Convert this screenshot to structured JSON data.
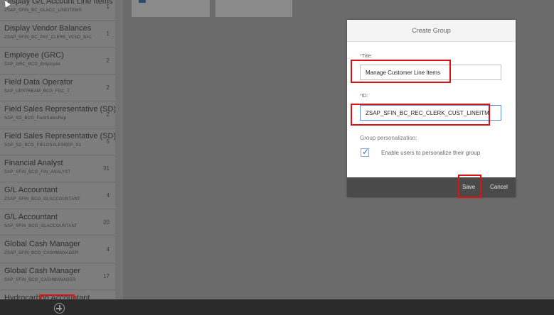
{
  "sidebar": {
    "items": [
      {
        "title": "Display G/L Account Line Items",
        "subtitle": "ZSAP_SFIN_BC_GLACC_LINEITEMS",
        "count": "1"
      },
      {
        "title": "Display Vendor Balances",
        "subtitle": "ZSAP_SFIN_BC_PAY_CLERK_VEND_BAL",
        "count": "1"
      },
      {
        "title": "Employee (GRC)",
        "subtitle": "SAP_GRC_BCG_Employee",
        "count": "2"
      },
      {
        "title": "Field Data Operator",
        "subtitle": "SAP_UPSTREAM_BCG_FDC_T",
        "count": "2"
      },
      {
        "title": "Field Sales Representative (SD)",
        "subtitle": "SAP_SD_BCG_FieldSalesRep",
        "count": "2"
      },
      {
        "title": "Field Sales Representative (SD)",
        "subtitle": "SAP_SD_BCG_FIELDSALESREP_X1",
        "count": "5"
      },
      {
        "title": "Financial Analyst",
        "subtitle": "SAP_SFIN_BCG_FIN_ANALYST",
        "count": "31"
      },
      {
        "title": "G/L Accountant",
        "subtitle": "ZSAP_SFIN_BCG_GLACCOUNTANT",
        "count": "4"
      },
      {
        "title": "G/L Accountant",
        "subtitle": "SAP_SFIN_BCG_GLACCOUNTANT",
        "count": "20"
      },
      {
        "title": "Global Cash Manager",
        "subtitle": "ZSAP_SFIN_BCG_CASHMANAGER",
        "count": "4"
      },
      {
        "title": "Global Cash Manager",
        "subtitle": "SAP_SFIN_BCG_CASHMANAGER",
        "count": "17"
      },
      {
        "title": "Hydrocarbon Accountant",
        "subtitle": "",
        "count": ""
      }
    ]
  },
  "dialog": {
    "title": "Create Group",
    "title_label": "Title:",
    "title_value": "Manage Customer Line Items",
    "id_label": "ID:",
    "id_value": "ZSAP_SFIN_BC_REC_CLERK_CUST_LINEITM",
    "required_marker": "*",
    "group_personalization_label": "Group personalization:",
    "checkbox_label": "Enable users to personalize their group",
    "checkbox_checked": true,
    "save_label": "Save",
    "cancel_label": "Cancel"
  },
  "icons": {
    "add": "plus-circle-icon",
    "check": "checkmark-icon"
  },
  "colors": {
    "highlight": "#e01010",
    "footer": "#4a4a4a",
    "focus_border": "#5b8fd6"
  }
}
